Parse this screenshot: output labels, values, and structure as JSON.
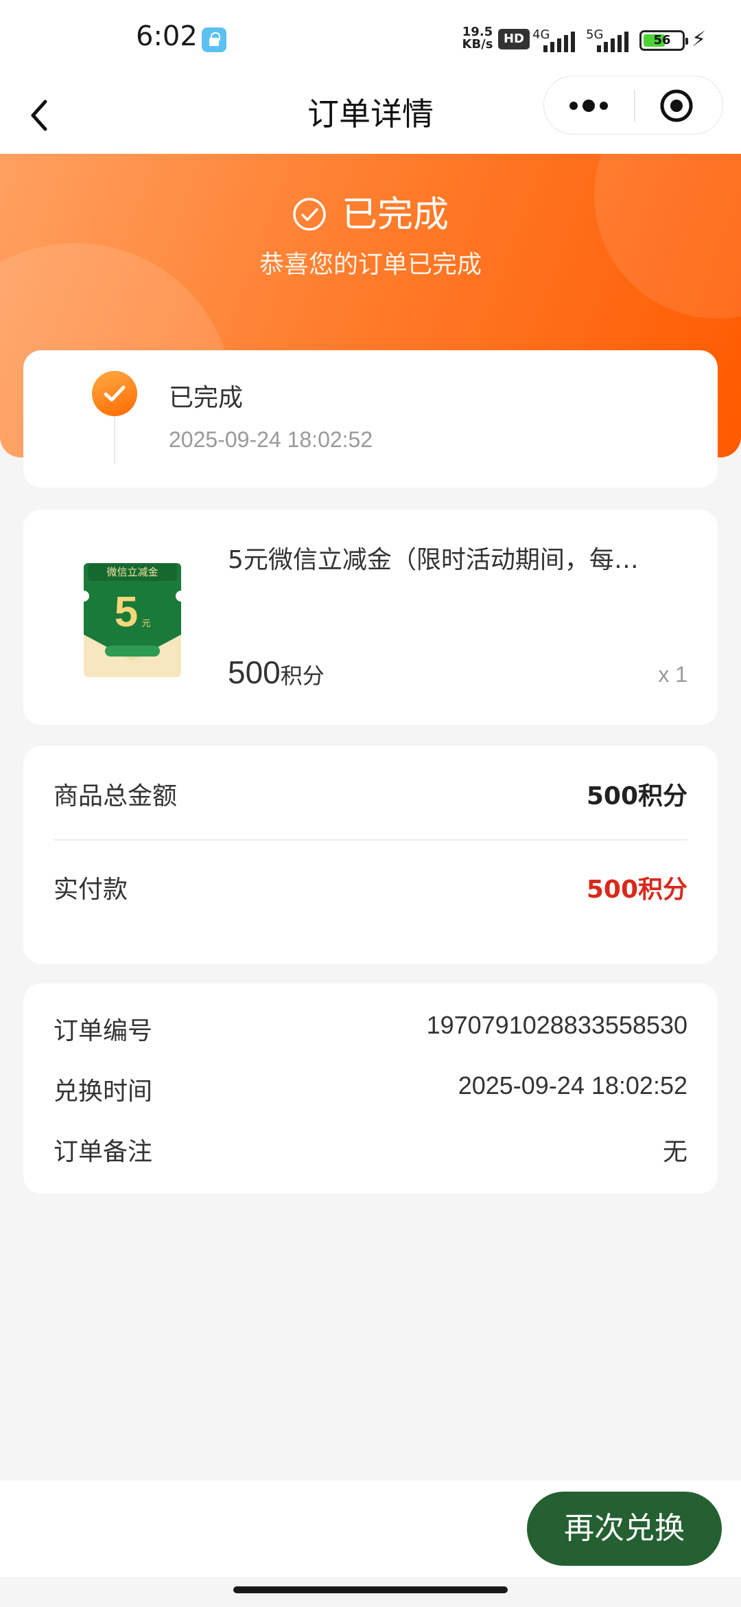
{
  "status_bar": {
    "time": "6:02",
    "net_speed": "19.5 KB/s",
    "hd": "HD",
    "net1": "4G",
    "net2": "5G",
    "battery": "56"
  },
  "nav": {
    "title": "订单详情"
  },
  "hero": {
    "status": "已完成",
    "subtitle": "恭喜您的订单已完成"
  },
  "timeline": {
    "title": "已完成",
    "time": "2025-09-24 18:02:52"
  },
  "goods": {
    "name": "5元微信立减金（限时活动期间，每…",
    "price": "500",
    "price_unit": "积分",
    "quantity": "x 1",
    "image_text": {
      "header": "微信立减金",
      "amount": "5",
      "unit": "元"
    }
  },
  "amount": {
    "total_label": "商品总金额",
    "total_value": "500积分",
    "paid_label": "实付款",
    "paid_value": "500积分"
  },
  "order_info": {
    "number_label": "订单编号",
    "number_value": "1970791028833558530",
    "time_label": "兑换时间",
    "time_value": "2025-09-24 18:02:52",
    "remark_label": "订单备注",
    "remark_value": "无"
  },
  "actions": {
    "reorder": "再次兑换"
  },
  "colors": {
    "accent_orange": "#ff6a00",
    "paid_red": "#d9291c",
    "button_green": "#256032"
  }
}
